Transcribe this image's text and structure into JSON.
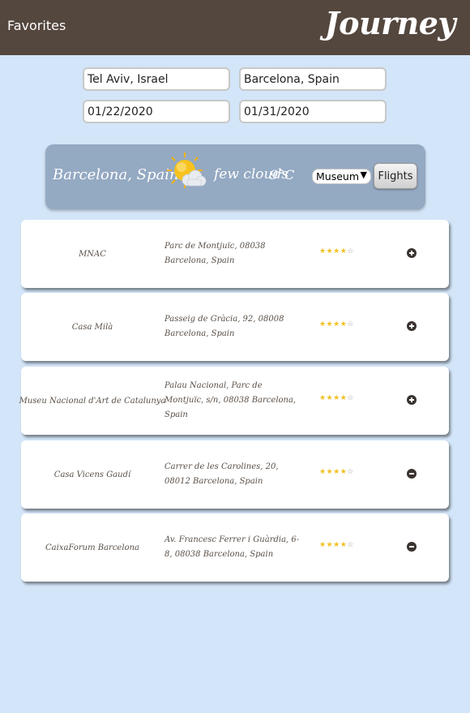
{
  "header": {
    "favorites_label": "Favorites",
    "brand": "Journey"
  },
  "search": {
    "origin": "Tel Aviv, Israel",
    "destination": "Barcelona, Spain",
    "depart_date": "01/22/2020",
    "return_date": "01/31/2020"
  },
  "weather": {
    "city": "Barcelona, Spain",
    "icon": "few-clouds-icon",
    "description": "few clouds",
    "temperature": "9°C",
    "category_selected": "Museum",
    "flights_label": "Flights"
  },
  "results": [
    {
      "name": "MNAC",
      "address": "Parc de Montjuïc, 08038 Barcelona, Spain",
      "rating": 4,
      "action": "add"
    },
    {
      "name": "Casa Milà",
      "address": "Passeig de Gràcia, 92, 08008 Barcelona, Spain",
      "rating": 4,
      "action": "add"
    },
    {
      "name": "Museu Nacional d'Art de Catalunya",
      "address": "Palau Nacional, Parc de Montjuïc, s/n, 08038 Barcelona, Spain",
      "rating": 4,
      "action": "add"
    },
    {
      "name": "Casa Vicens Gaudí",
      "address": "Carrer de les Carolines, 20, 08012 Barcelona, Spain",
      "rating": 4,
      "action": "remove"
    },
    {
      "name": "CaixaForum Barcelona",
      "address": "Av. Francesc Ferrer i Guàrdia, 6-8, 08038 Barcelona, Spain",
      "rating": 4,
      "action": "remove"
    }
  ],
  "colors": {
    "header_bg": "#54473e",
    "page_bg": "#d3e5f8",
    "banner_bg": "#94a9c2",
    "star": "#f0c020"
  }
}
